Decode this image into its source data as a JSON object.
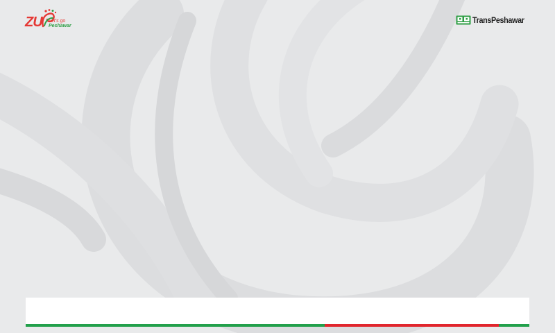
{
  "brand_left": {
    "wordmark": "ZU",
    "tagline_line1": "Let's go",
    "tagline_line2": "Peshawar",
    "icon": "leaf-flame-icon",
    "color_red": "#e53935",
    "color_green": "#2e9e44"
  },
  "brand_right": {
    "name": "TransPeshawar",
    "icon": "bus-icon",
    "color_green": "#2e9e44"
  },
  "footer": {
    "card_color": "#ffffff",
    "stripe_colors": [
      "#22a04b",
      "#e1262d",
      "#22a04b"
    ]
  },
  "background": {
    "color": "#e9eaeb",
    "swirl_color": "#d9dadc"
  }
}
